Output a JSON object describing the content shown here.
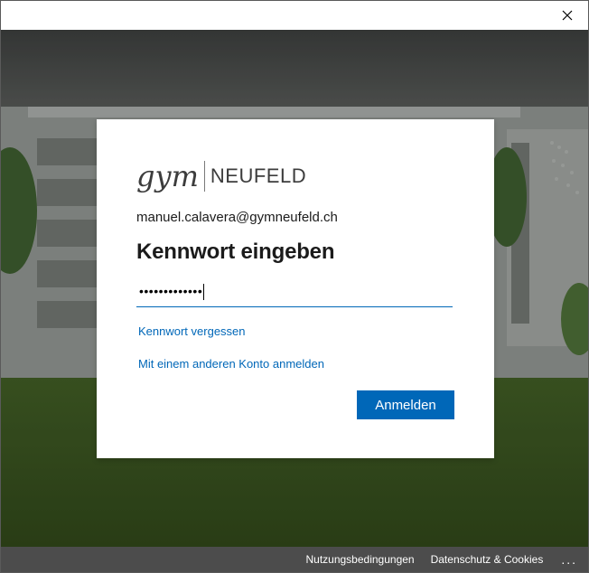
{
  "window": {
    "close_icon": "close-icon"
  },
  "logo": {
    "gym": "gym",
    "neufeld": "NEUFELD"
  },
  "account": {
    "email": "manuel.calavera@gymneufeld.ch"
  },
  "form": {
    "title": "Kennwort eingeben",
    "password_masked": "•••••••••••••",
    "forgot_link": "Kennwort vergessen",
    "other_account_link": "Mit einem anderen Konto anmelden",
    "signin_button": "Anmelden"
  },
  "footer": {
    "terms": "Nutzungsbedingungen",
    "privacy": "Datenschutz & Cookies",
    "more": "..."
  },
  "colors": {
    "accent": "#0067b8",
    "footer_bg": "#000000"
  }
}
